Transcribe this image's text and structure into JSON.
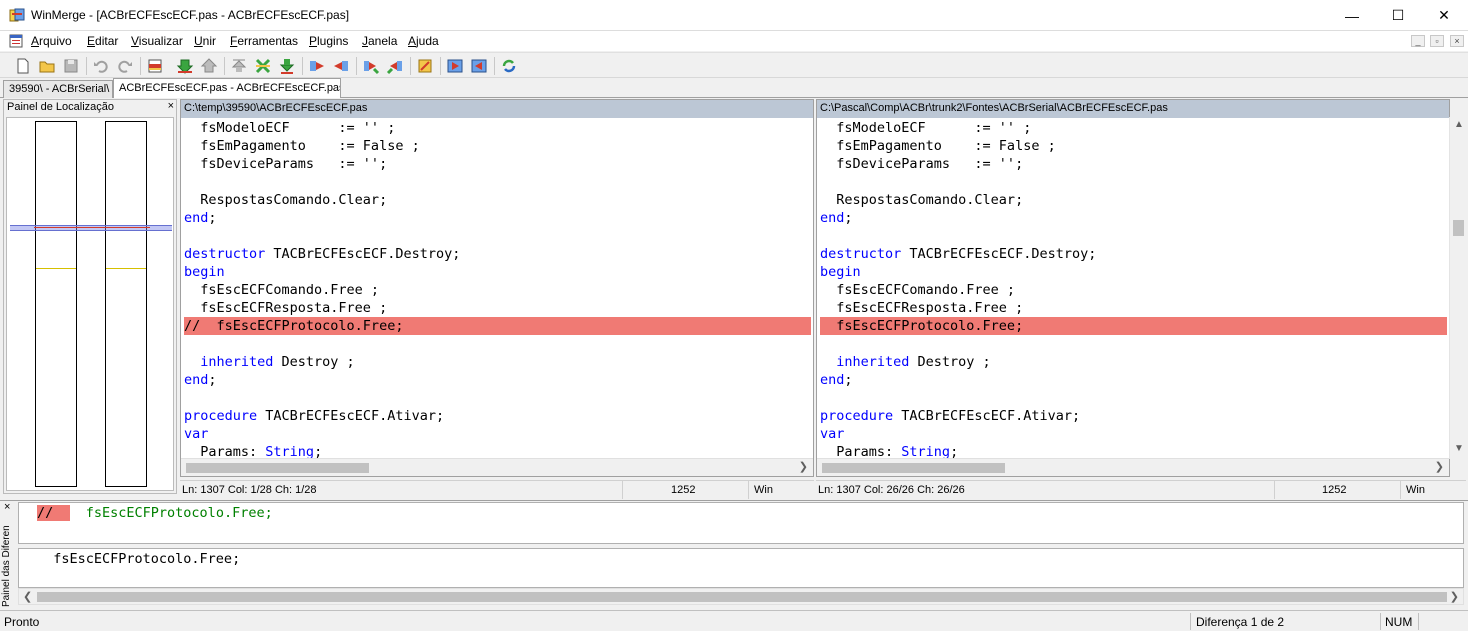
{
  "window": {
    "title": "WinMerge - [ACBrECFEscECF.pas - ACBrECFEscECF.pas]",
    "minimize": "—",
    "maximize": "☐",
    "close": "✕"
  },
  "menu": {
    "items": [
      {
        "first": "A",
        "rest": "rquivo"
      },
      {
        "first": "E",
        "rest": "ditar"
      },
      {
        "first": "V",
        "rest": "isualizar"
      },
      {
        "first": "U",
        "rest": "nir"
      },
      {
        "first": "F",
        "rest": "erramentas"
      },
      {
        "first": "P",
        "rest": "lugins"
      },
      {
        "first": "J",
        "rest": "anela"
      },
      {
        "first": "A",
        "rest": "juda"
      }
    ],
    "mdi_minimize": "_",
    "mdi_restore": "▫",
    "mdi_close": "×"
  },
  "tabs": [
    {
      "label": "39590\\ - ACBrSerial\\"
    },
    {
      "label": "ACBrECFEscECF.pas - ACBrECFEscECF.pas"
    }
  ],
  "location_pane": {
    "title": "Painel de Localização",
    "close": "×"
  },
  "left_pane": {
    "path": "C:\\temp\\39590\\ACBrECFEscECF.pas",
    "status": {
      "pos": "Ln: 1307  Col: 1/28  Ch: 1/28",
      "codepage": "1252",
      "eol": "Win"
    }
  },
  "right_pane": {
    "path": "C:\\Pascal\\Comp\\ACBr\\trunk2\\Fontes\\ACBrSerial\\ACBrECFEscECF.pas",
    "status": {
      "pos": "Ln: 1307  Col: 26/26  Ch: 26/26",
      "codepage": "1252",
      "eol": "Win"
    }
  },
  "code_lines": {
    "l0": "  fsModeloECF      := '' ;",
    "l1": "  fsEmPagamento    := False ;",
    "l2": "  fsDeviceParams   := '';",
    "l4": "  RespostasComando.Clear;",
    "l5_kw": "end",
    "l5_rest": ";",
    "l7_kw": "destructor",
    "l7_rest": " TACBrECFEscECF.Destroy;",
    "l8_kw": "begin",
    "l9": "  fsEscECFComando.Free ;",
    "l10": "  fsEscECFResposta.Free ;",
    "l11_left": "//  fsEscECFProtocolo.Free;",
    "l11_right": "  fsEscECFProtocolo.Free;",
    "l13_kw": "  inherited",
    "l13_rest": " Destroy ;",
    "l14_kw": "end",
    "l14_rest": ";",
    "l16_kw": "procedure",
    "l16_rest": " TACBrECFEscECF.Ativar;",
    "l17_kw": "var",
    "l18_a": "  Params: ",
    "l18_kw": "String",
    "l18_rest": ";"
  },
  "diff_pane": {
    "label": "Painel das Diferen",
    "close": "×",
    "left_mark": "//  ",
    "left_text": "  fsEscECFProtocolo.Free;",
    "right_text": "  fsEscECFProtocolo.Free;"
  },
  "statusbar": {
    "ready": "Pronto",
    "diff_count": "Diferença 1 de 2",
    "num": "NUM"
  },
  "colors": {
    "diff_line": "#f07a74",
    "keyword": "#0000ff",
    "pane_header": "#bcc7d5"
  }
}
